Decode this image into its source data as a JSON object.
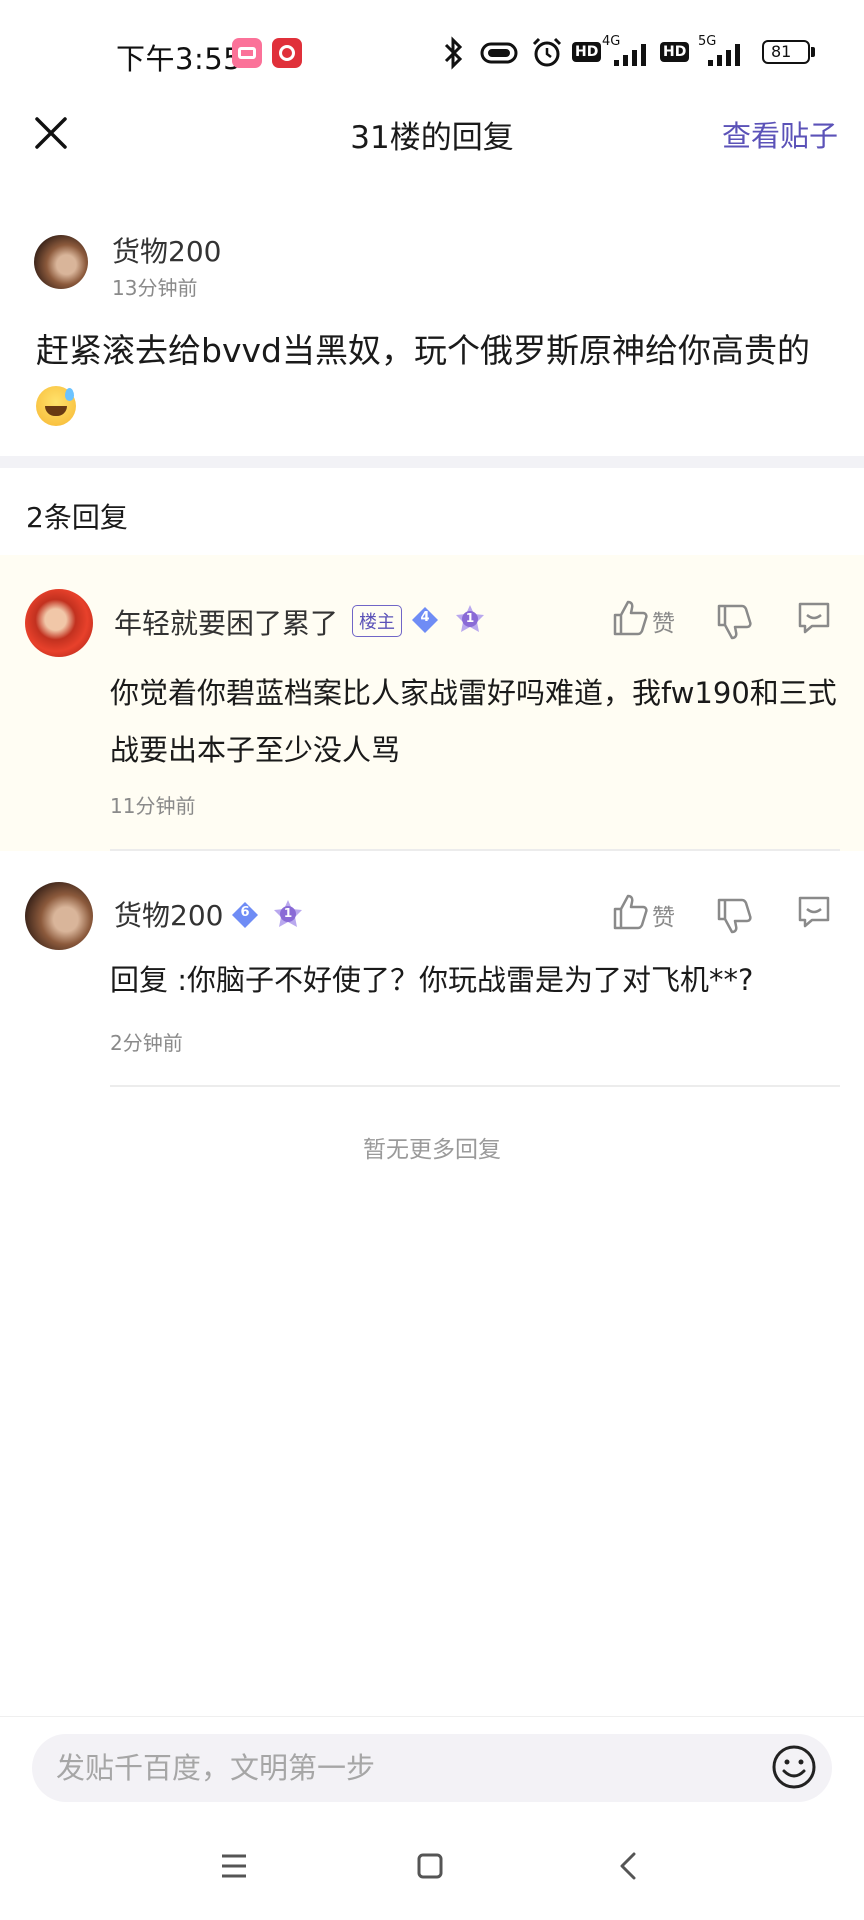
{
  "status_bar": {
    "time": "下午3:55",
    "network_1": "4G",
    "network_2": "5G",
    "hd_label": "HD",
    "battery": "81"
  },
  "header": {
    "title": "31楼的回复",
    "view_post": "查看贴子"
  },
  "post": {
    "author": "货物200",
    "time": "13分钟前",
    "body": "赶紧滚去给bvvd当黑奴，玩个俄罗斯原神给你高贵的"
  },
  "reply_count": "2条回复",
  "replies": [
    {
      "name": "年轻就要困了累了",
      "op_tag": "楼主",
      "level": "4",
      "rank": "1",
      "like_label": "赞",
      "body": "你觉着你碧蓝档案比人家战雷好吗难道，我fw190和三式战要出本子至少没人骂",
      "time": "11分钟前"
    },
    {
      "name": "货物200",
      "level": "6",
      "rank": "1",
      "like_label": "赞",
      "body": "回复   :你脑子不好使了？你玩战雷是为了对飞机**?",
      "time": "2分钟前"
    }
  ],
  "no_more": "暂无更多回复",
  "input": {
    "placeholder": "发贴千百度，文明第一步"
  },
  "colors": {
    "accent": "#5b52b8",
    "highlight_row": "#fffdf3",
    "gem_blue": "#6f8cf5",
    "star_purple": "#8a6bd6"
  }
}
